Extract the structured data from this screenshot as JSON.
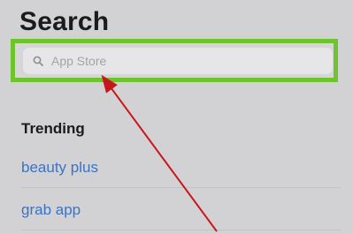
{
  "header": {
    "title": "Search"
  },
  "search": {
    "placeholder": "App Store"
  },
  "trending": {
    "title": "Trending",
    "items": [
      {
        "label": "beauty plus"
      },
      {
        "label": "grab app"
      }
    ]
  },
  "colors": {
    "highlight_border": "#6fc32c",
    "link": "#3b73c4",
    "arrow": "#c8171c"
  }
}
